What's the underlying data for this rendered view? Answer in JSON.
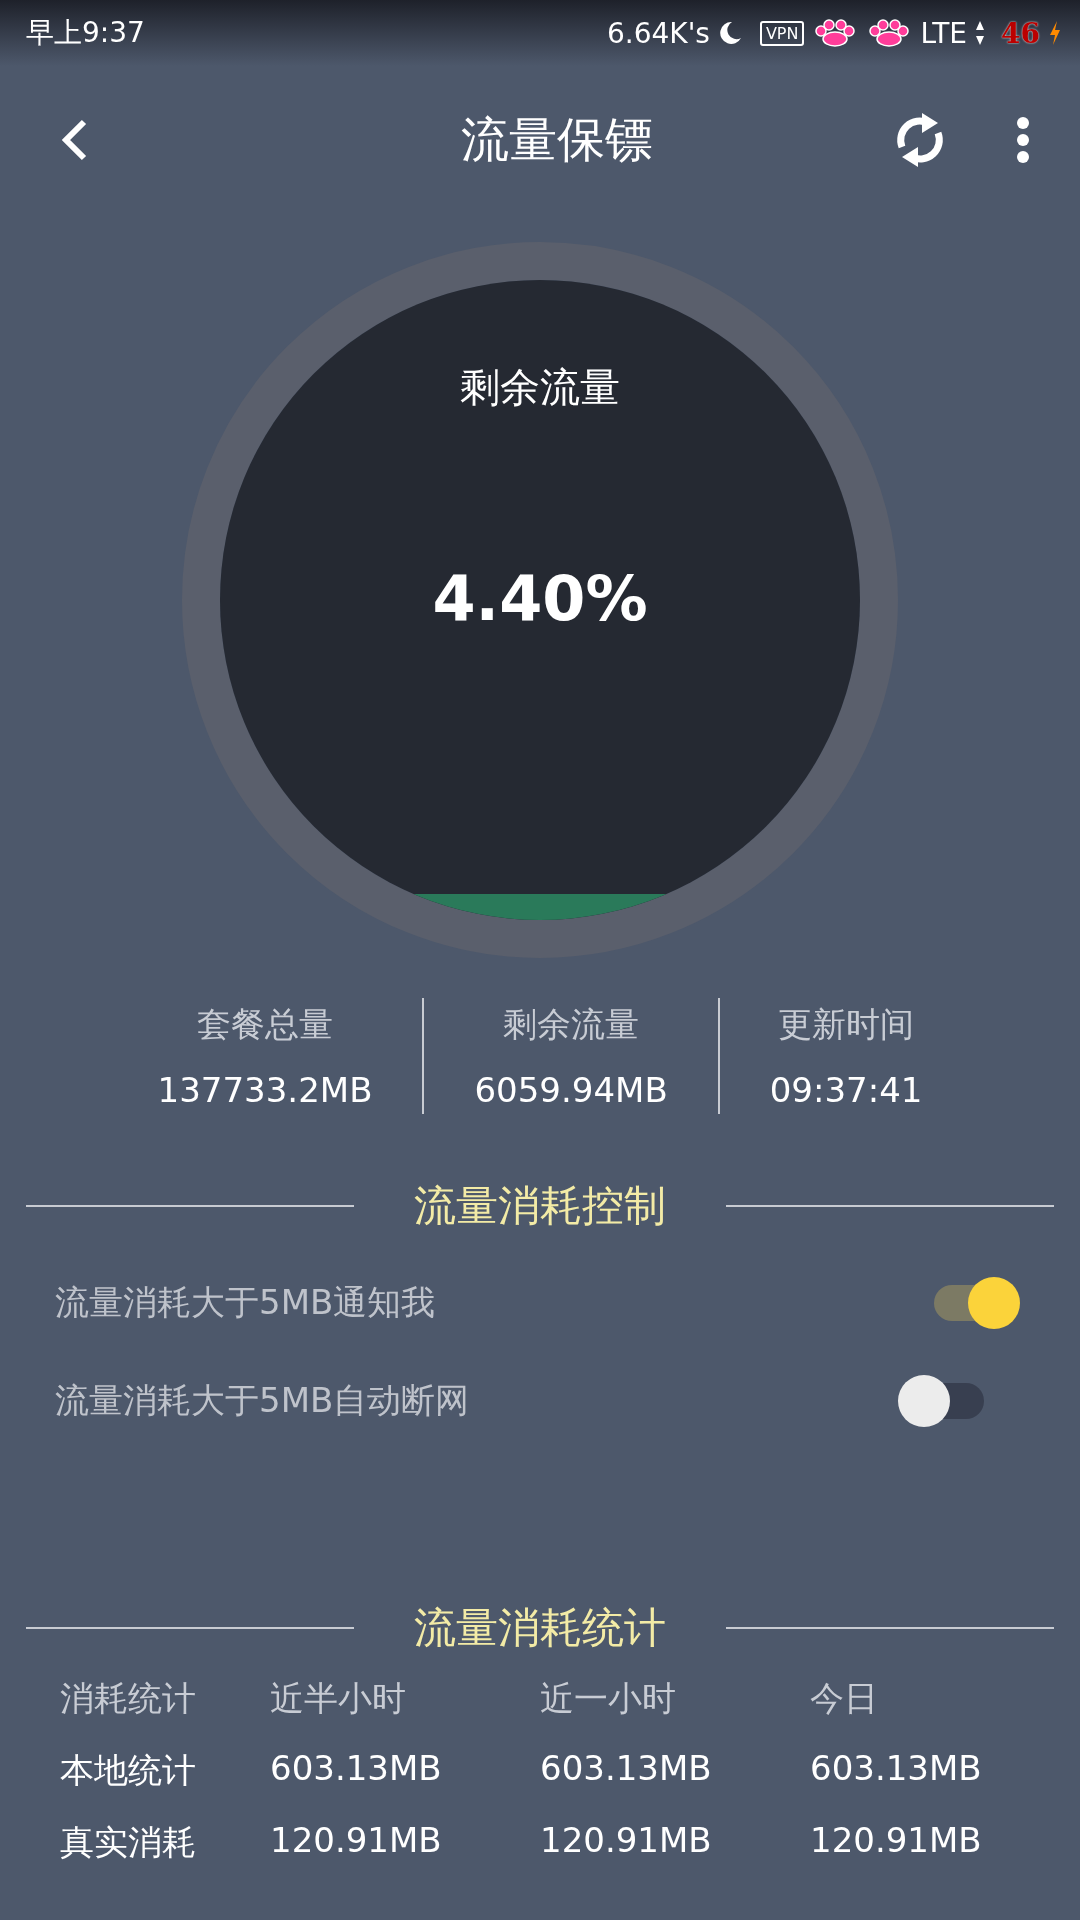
{
  "status_bar": {
    "time": "早上9:37",
    "speed": "6.64K's",
    "vpn": "VPN",
    "network": "LTE",
    "battery": "46"
  },
  "toolbar": {
    "title": "流量保镖"
  },
  "gauge": {
    "label": "剩余流量",
    "percent": "4.40%"
  },
  "summary": [
    {
      "label": "套餐总量",
      "value": "137733.2MB"
    },
    {
      "label": "剩余流量",
      "value": "6059.94MB"
    },
    {
      "label": "更新时间",
      "value": "09:37:41"
    }
  ],
  "control_section": {
    "title": "流量消耗控制",
    "settings": [
      {
        "label": "流量消耗大于5MB通知我",
        "on": true
      },
      {
        "label": "流量消耗大于5MB自动断网",
        "on": false
      }
    ]
  },
  "stats_section": {
    "title": "流量消耗统计",
    "columns": [
      "消耗统计",
      "近半小时",
      "近一小时",
      "今日"
    ],
    "rows": [
      [
        "本地统计",
        "603.13MB",
        "603.13MB",
        "603.13MB"
      ],
      [
        "真实消耗",
        "120.91MB",
        "120.91MB",
        "120.91MB"
      ]
    ]
  }
}
